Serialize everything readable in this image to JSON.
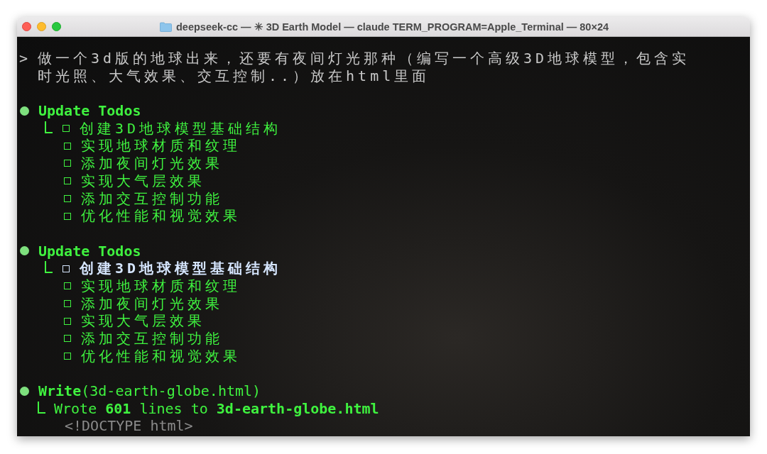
{
  "window": {
    "title": "deepseek-cc — ✳ 3D Earth Model — claude TERM_PROGRAM=Apple_Terminal — 80×24"
  },
  "terminal": {
    "prompt": {
      "symbol": ">",
      "lines": [
        "做一个3d版的地球出来，还要有夜间灯光那种（编写一个高级3D地球模型，包含实",
        "时光照、大气效果、交互控制..）放在html里面"
      ]
    },
    "sections": [
      {
        "kind": "todos",
        "title": "Update Todos",
        "items": [
          {
            "text": "创建3D地球模型基础结构",
            "checked": false,
            "active": false
          },
          {
            "text": "实现地球材质和纹理",
            "checked": false,
            "active": false
          },
          {
            "text": "添加夜间灯光效果",
            "checked": false,
            "active": false
          },
          {
            "text": "实现大气层效果",
            "checked": false,
            "active": false
          },
          {
            "text": "添加交互控制功能",
            "checked": false,
            "active": false
          },
          {
            "text": "优化性能和视觉效果",
            "checked": false,
            "active": false
          }
        ]
      },
      {
        "kind": "todos",
        "title": "Update Todos",
        "items": [
          {
            "text": "创建3D地球模型基础结构",
            "checked": false,
            "active": true
          },
          {
            "text": "实现地球材质和纹理",
            "checked": false,
            "active": false
          },
          {
            "text": "添加夜间灯光效果",
            "checked": false,
            "active": false
          },
          {
            "text": "实现大气层效果",
            "checked": false,
            "active": false
          },
          {
            "text": "添加交互控制功能",
            "checked": false,
            "active": false
          },
          {
            "text": "优化性能和视觉效果",
            "checked": false,
            "active": false
          }
        ]
      },
      {
        "kind": "write",
        "title": "**Write**(3d-earth-globe.html)",
        "result": "Wrote **601** lines to **3d-earth-globe.html**",
        "preview": "<!DOCTYPE html>"
      }
    ]
  }
}
